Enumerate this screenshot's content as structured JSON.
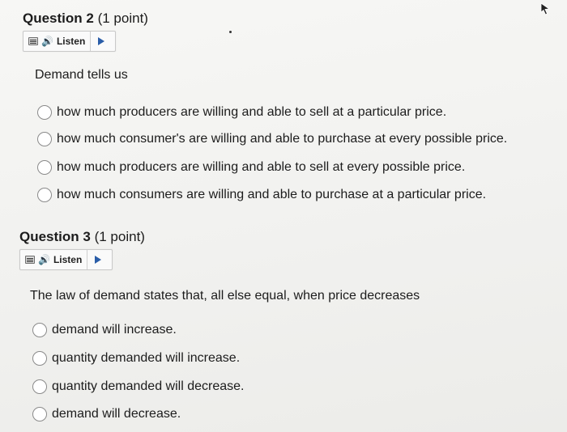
{
  "questions": [
    {
      "title": "Question 2",
      "points": "(1 point)",
      "listen_label": "Listen",
      "prompt": "Demand tells us",
      "options": [
        "how much producers are willing and able to sell at a particular price.",
        "how much consumer's are willing and able to purchase at every possible price.",
        "how much producers are willing and able to sell at every possible price.",
        "how much consumers are willing and able to purchase at a particular price."
      ]
    },
    {
      "title": "Question 3",
      "points": "(1 point)",
      "listen_label": "Listen",
      "prompt": "The law of demand states that, all else equal, when price decreases",
      "options": [
        "demand will increase.",
        "quantity demanded will increase.",
        "quantity demanded will decrease.",
        "demand will decrease."
      ]
    }
  ],
  "icons": {
    "menu": "menu-icon",
    "speaker": "speaker-icon",
    "play": "play-icon",
    "cursor": "cursor-icon"
  },
  "colors": {
    "play": "#2a5da8"
  }
}
